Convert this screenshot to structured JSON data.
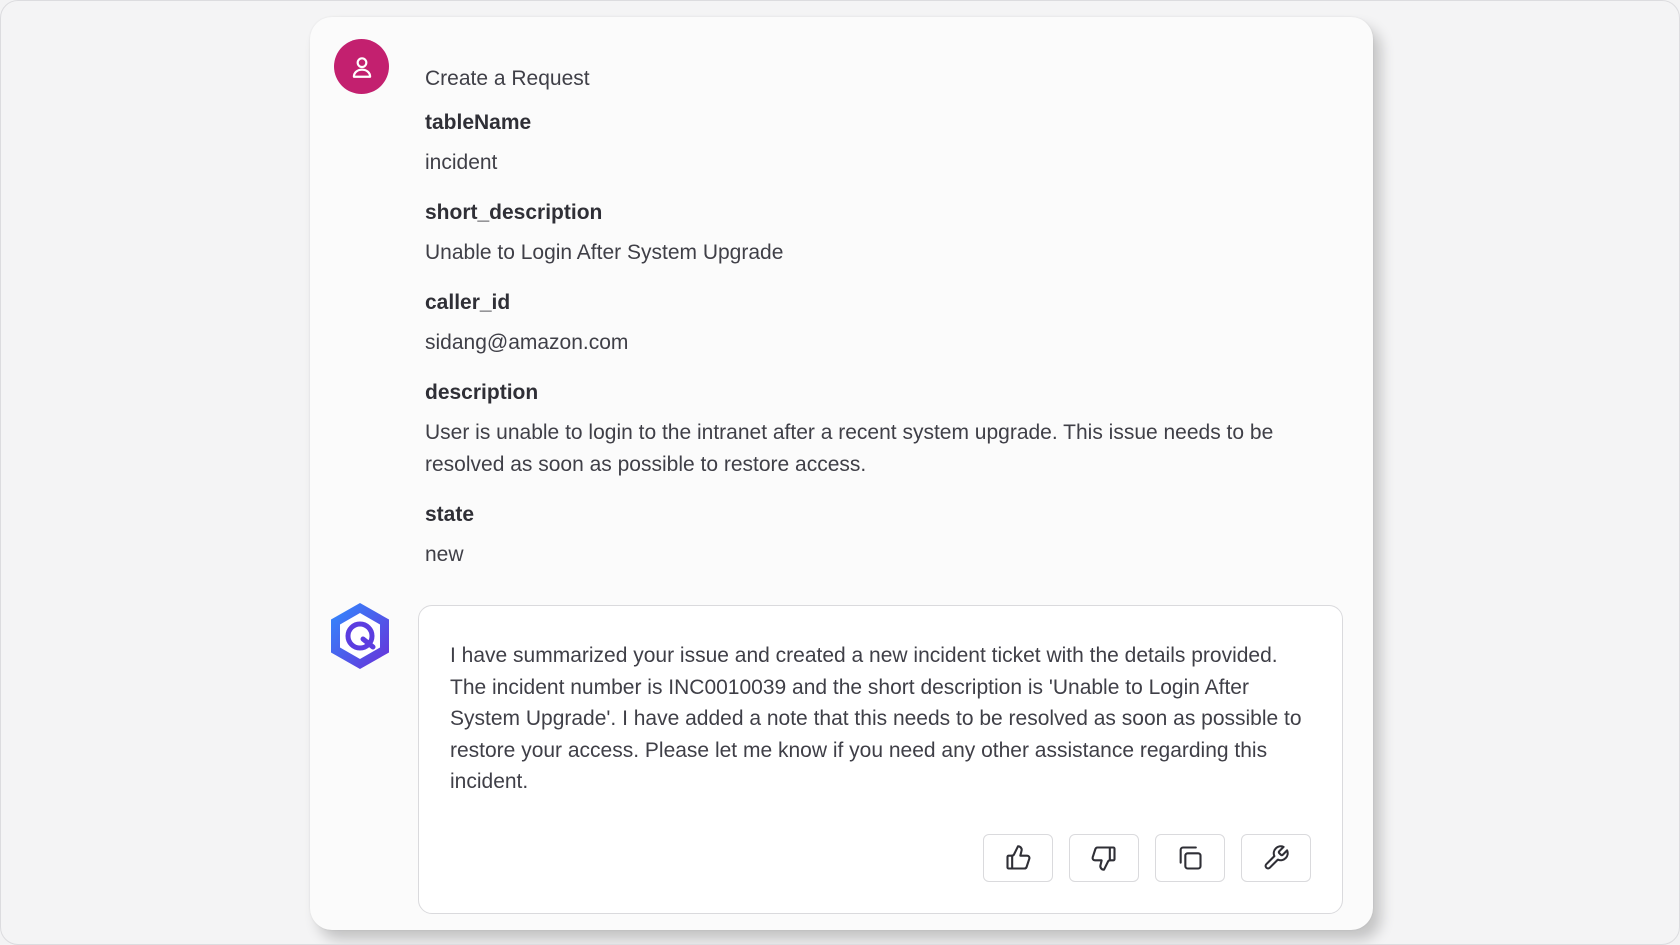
{
  "conversation": {
    "user_message": {
      "title": "Create a Request",
      "fields": [
        {
          "key": "tableName",
          "value": "incident"
        },
        {
          "key": "short_description",
          "value": "Unable to Login After System Upgrade"
        },
        {
          "key": "caller_id",
          "value": "sidang@amazon.com"
        },
        {
          "key": "description",
          "value": "User is unable to login to the intranet after a recent system upgrade. This issue needs to be resolved as soon as possible to restore access."
        },
        {
          "key": "state",
          "value": "new"
        }
      ]
    },
    "assistant_message": {
      "text": "I have summarized your issue and created a new incident ticket with the details provided. The incident number is INC0010039 and the short description is 'Unable to Login After System Upgrade'. I have added a note that this needs to be resolved as soon as possible to restore your access. Please let me know if you need any other assistance regarding this incident."
    },
    "actions": [
      {
        "name": "thumbs-up",
        "icon": "thumbs-up-icon"
      },
      {
        "name": "thumbs-down",
        "icon": "thumbs-down-icon"
      },
      {
        "name": "copy",
        "icon": "copy-icon"
      },
      {
        "name": "tools",
        "icon": "wrench-icon"
      }
    ]
  },
  "colors": {
    "user_avatar": "#c3206f",
    "bot_logo_primary": "#5b3de0",
    "bot_logo_secondary": "#1e90ff"
  }
}
